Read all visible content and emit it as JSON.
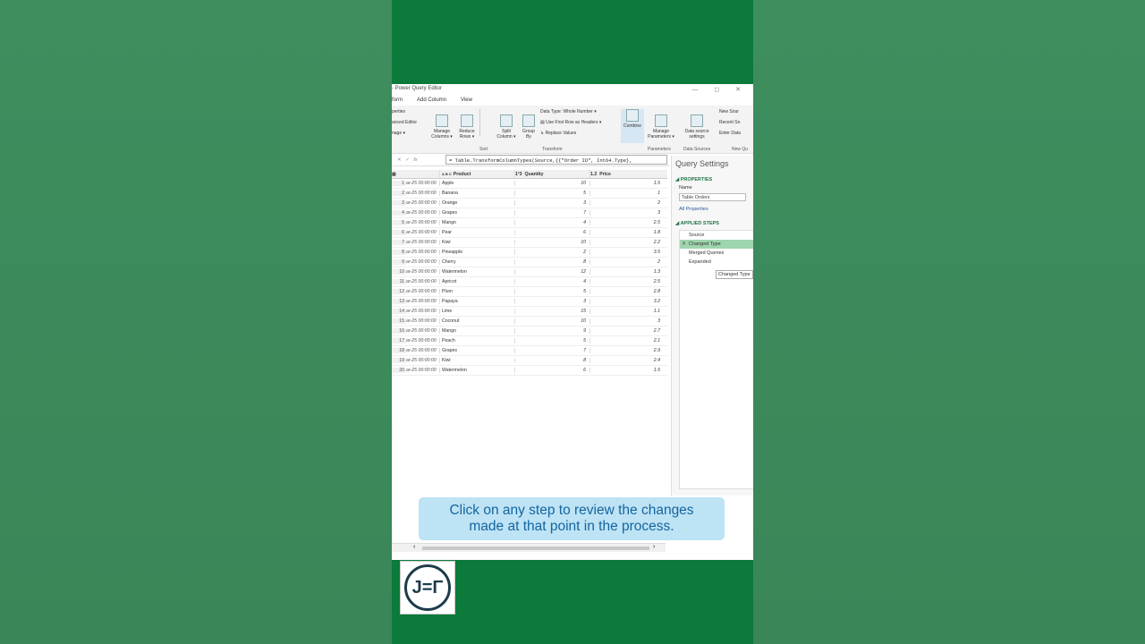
{
  "window": {
    "title": "- Power Query Editor",
    "controls": "— ◻ ✕"
  },
  "menu": {
    "tabs": [
      "form",
      "Add Column",
      "View"
    ]
  },
  "ribbon": {
    "properties": "perties",
    "advanced_editor": "anced Editor",
    "manage": "nage ▾",
    "manage_columns": "Manage\nColumns ▾",
    "reduce_rows": "Reduce\nRows ▾",
    "split_column": "Split\nColumn ▾",
    "group_by": "Group\nBy",
    "data_type": "Data Type: Whole Number ▾",
    "first_row_headers": "Use First Row as Headers ▾",
    "replace_values": "Replace Values",
    "combine": "Combine",
    "manage_parameters": "Manage\nParameters ▾",
    "data_source_settings": "Data source\nsettings",
    "new_source": "New Sour",
    "recent_sources": "Recent So",
    "enter_data": "Enter Data",
    "groups": {
      "sort": "Sort",
      "transform": "Transform",
      "parameters": "Parameters",
      "data_sources": "Data Sources",
      "new_query": "New Qu"
    }
  },
  "formula": {
    "code": "= Table.TransformColumnTypes(Source,{{\"Order ID\", Int64.Type},"
  },
  "grid": {
    "headers": {
      "product": "Product",
      "quantity": "Quantity",
      "price": "Price",
      "abc": "A B C",
      "num": "1²3",
      "dec": "1.2"
    },
    "rows": [
      {
        "n": "1",
        "d": "ar-25 00:00:00",
        "p": "Apple",
        "q": "10",
        "pr": "1.5"
      },
      {
        "n": "2",
        "d": "ar-25 00:00:00",
        "p": "Banana",
        "q": "5",
        "pr": "1"
      },
      {
        "n": "3",
        "d": "ar-25 00:00:00",
        "p": "Orange",
        "q": "3",
        "pr": "2"
      },
      {
        "n": "4",
        "d": "ar-25 00:00:00",
        "p": "Grapes",
        "q": "7",
        "pr": "3"
      },
      {
        "n": "5",
        "d": "ar-25 00:00:00",
        "p": "Mango",
        "q": "4",
        "pr": "2.5"
      },
      {
        "n": "6",
        "d": "ar-25 00:00:00",
        "p": "Pear",
        "q": "6",
        "pr": "1.8"
      },
      {
        "n": "7",
        "d": "ar-25 00:00:00",
        "p": "Kiwi",
        "q": "10",
        "pr": "2.2"
      },
      {
        "n": "8",
        "d": "ar-25 00:00:00",
        "p": "Pineapple",
        "q": "2",
        "pr": "3.5"
      },
      {
        "n": "9",
        "d": "ar-25 00:00:00",
        "p": "Cherry",
        "q": "8",
        "pr": "2"
      },
      {
        "n": "10",
        "d": "ar-25 00:00:00",
        "p": "Watermelon",
        "q": "12",
        "pr": "1.3"
      },
      {
        "n": "11",
        "d": "ar-25 00:00:00",
        "p": "Apricot",
        "q": "4",
        "pr": "2.5"
      },
      {
        "n": "12",
        "d": "ar-25 00:00:00",
        "p": "Plum",
        "q": "5",
        "pr": "2.8"
      },
      {
        "n": "13",
        "d": "ar-25 00:00:00",
        "p": "Papaya",
        "q": "3",
        "pr": "3.2"
      },
      {
        "n": "14",
        "d": "ar-25 00:00:00",
        "p": "Lime",
        "q": "15",
        "pr": "1.1"
      },
      {
        "n": "15",
        "d": "ar-25 00:00:00",
        "p": "Coconut",
        "q": "10",
        "pr": "3"
      },
      {
        "n": "16",
        "d": "ar-25 00:00:00",
        "p": "Mango",
        "q": "9",
        "pr": "2.7"
      },
      {
        "n": "17",
        "d": "ar-25 00:00:00",
        "p": "Peach",
        "q": "5",
        "pr": "2.1"
      },
      {
        "n": "18",
        "d": "ar-25 00:00:00",
        "p": "Grapes",
        "q": "7",
        "pr": "2.9"
      },
      {
        "n": "19",
        "d": "ar-25 00:00:00",
        "p": "Kiwi",
        "q": "8",
        "pr": "2.4"
      },
      {
        "n": "20",
        "d": "ar-25 00:00:00",
        "p": "Watermelon",
        "q": "6",
        "pr": "1.5"
      }
    ]
  },
  "query_settings": {
    "title": "Query Settings",
    "properties": "PROPERTIES",
    "name_label": "Name",
    "name_value": "Table Orders",
    "all_properties": "All Properties",
    "applied_steps": "APPLIED STEPS",
    "steps": [
      "Source",
      "Changed Type",
      "Merged Queries",
      "Expanded"
    ],
    "tooltip": "Changed Type"
  },
  "caption": {
    "line1": "Click on any step to review the changes",
    "line2": "made at that point in the process."
  },
  "logo": {
    "text": "J=Γ"
  },
  "colors": {
    "excel_green": "#217346",
    "phone_bg": "#0b7a3b",
    "selected_step": "#9fd5ae",
    "caption_bg": "#bde3f5",
    "caption_text": "#1565a0"
  }
}
